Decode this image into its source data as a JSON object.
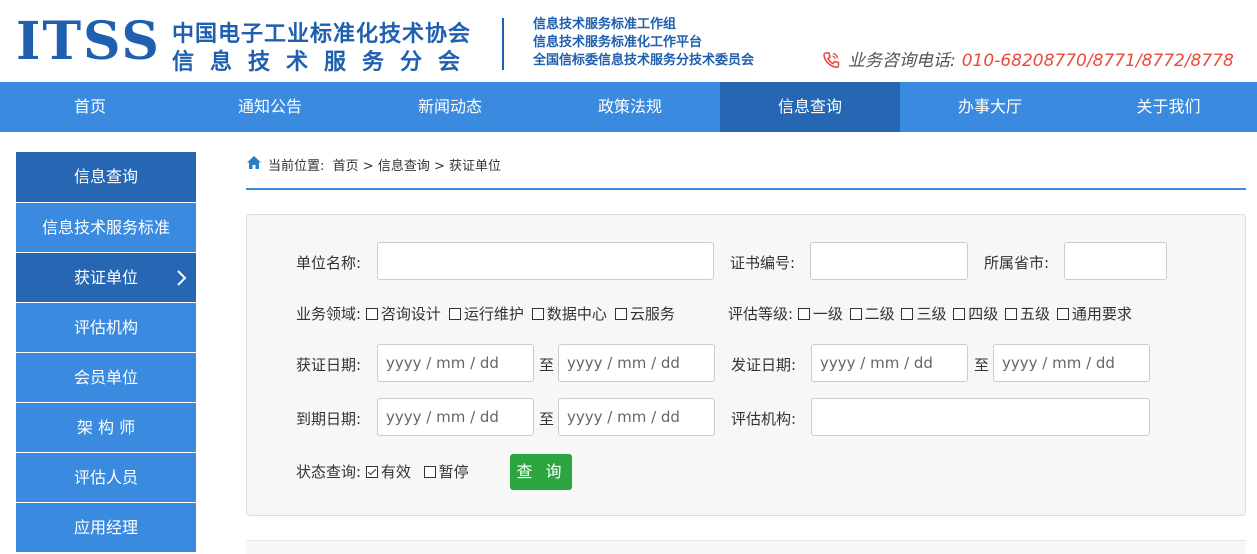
{
  "header": {
    "logo_text": "ITSS",
    "org_line1": "中国电子工业标准化技术协会",
    "org_line2": "信息技术服务分会",
    "sub_lines": [
      "信息技术服务标准工作组",
      "信息技术服务标准化工作平台",
      "全国信标委信息技术服务分技术委员会"
    ],
    "hotline_label": "业务咨询电话:",
    "hotline_number": "010-68208770/8771/8772/8778",
    "accent_color": "#1f5fb0",
    "hotline_color": "#e84b3c"
  },
  "nav": {
    "items": [
      "首页",
      "通知公告",
      "新闻动态",
      "政策法规",
      "信息查询",
      "办事大厅",
      "关于我们"
    ],
    "active": "信息查询",
    "bg_color": "#3a8ae0",
    "active_color": "#2766b3"
  },
  "sidebar": {
    "title": "信息查询",
    "items": [
      "信息技术服务标准",
      "获证单位",
      "评估机构",
      "会员单位",
      "架 构 师",
      "评估人员",
      "应用经理"
    ],
    "active": "获证单位"
  },
  "breadcrumb": {
    "prefix": "当前位置:",
    "path": "首页 > 信息查询 > 获证单位"
  },
  "form": {
    "company_label": "单位名称:",
    "company_value": "",
    "cert_no_label": "证书编号:",
    "cert_no_value": "",
    "province_label": "所属省市:",
    "province_value": "",
    "domain_label": "业务领域:",
    "domains": [
      "咨询设计",
      "运行维护",
      "数据中心",
      "云服务"
    ],
    "level_label": "评估等级:",
    "levels": [
      "一级",
      "二级",
      "三级",
      "四级",
      "五级",
      "通用要求"
    ],
    "cert_date_label": "获证日期:",
    "issue_date_label": "发证日期:",
    "expire_date_label": "到期日期:",
    "to_label": "至",
    "date_placeholder": "yyyy / mm / dd",
    "agency_label": "评估机构:",
    "agency_value": "",
    "status_label": "状态查询:",
    "status_options": [
      {
        "label": "有效",
        "checked": true
      },
      {
        "label": "暂停",
        "checked": false
      }
    ],
    "query_button": "查 询",
    "query_button_color": "#2aa53f"
  }
}
